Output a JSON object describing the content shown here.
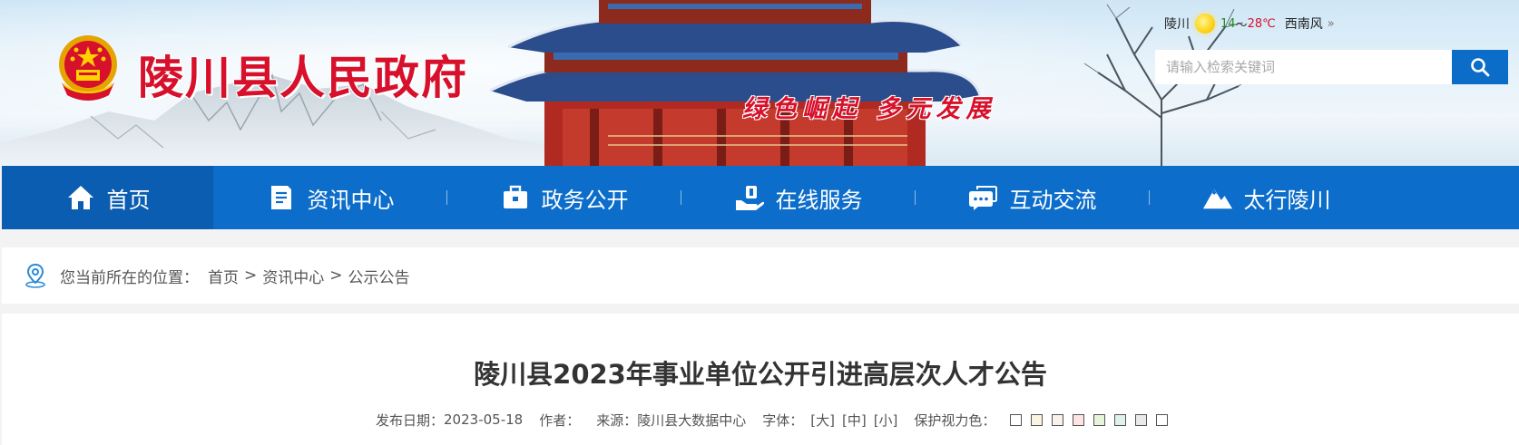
{
  "header": {
    "site_title": "陵川县人民政府",
    "slogan": "绿色崛起  多元发展",
    "emblem_icon": "national-emblem-icon",
    "weather": {
      "city": "陵川",
      "icon": "sun-icon",
      "temp_low": "14",
      "temp_sep": "～",
      "temp_high": "28℃",
      "wind": "西南风",
      "more_icon": "double-chevron-right-icon",
      "more_glyph": "»"
    },
    "search": {
      "placeholder": "请输入检索关键词",
      "button_icon": "search-icon"
    }
  },
  "nav": {
    "items": [
      {
        "label": "首页",
        "icon": "home-icon",
        "active": true
      },
      {
        "label": "资讯中心",
        "icon": "document-icon"
      },
      {
        "label": "政务公开",
        "icon": "briefcase-icon"
      },
      {
        "label": "在线服务",
        "icon": "service-hand-icon"
      },
      {
        "label": "互动交流",
        "icon": "chat-bubble-icon"
      },
      {
        "label": "太行陵川",
        "icon": "mountain-icon"
      }
    ]
  },
  "breadcrumb": {
    "icon": "location-pin-icon",
    "prefix": "您当前所在的位置：",
    "items": [
      "首页",
      "资讯中心",
      "公示公告"
    ],
    "separator": ">"
  },
  "article": {
    "title": "陵川县2023年事业单位公开引进高层次人才公告",
    "meta": {
      "date_label": "发布日期：",
      "date": "2023-05-18",
      "author_label": "作者：",
      "author": "",
      "source_label": "来源：",
      "source": "陵川县大数据中心",
      "font_label": "字体：",
      "font_large": "[大]",
      "font_medium": "[中]",
      "font_small": "[小]",
      "eye_label": "保护视力色：",
      "eye_colors": [
        "#ffffff",
        "#faf5e0",
        "#faf0ee",
        "#fde3e3",
        "#e6f4d9",
        "#e0f1e8",
        "#e9e9e9",
        "#ffffff"
      ]
    }
  },
  "colors": {
    "brand_blue": "#0c6dca",
    "active_blue": "#0a5db0",
    "title_red": "#d7102b"
  }
}
